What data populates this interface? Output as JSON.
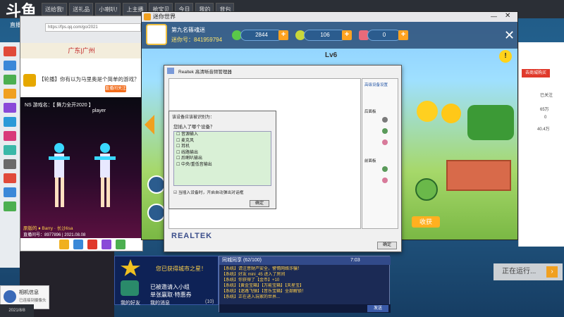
{
  "top_taskbar": {
    "items": [
      "送给我!",
      "送礼品",
      "小喇叭!",
      "上主播",
      "抢宝贝",
      "今日",
      "我的",
      "背包"
    ]
  },
  "douyu": {
    "logo": "斗鱼",
    "sub": "直播间号"
  },
  "browser": {
    "url": "https://fps.qq.com/go/2021",
    "city_banner": "广东|广州",
    "stream_title": "【轮播】你有以为马里奥是个简单的游戏？",
    "follow_label": "直播间关注 100+",
    "ns_label": "NS 游戏名：【 舞力全开2020 】",
    "player_label": "player",
    "dance_caption": "原版的 ♦ Barry · 长沙lisa",
    "dance_id": "直播间号：8977896 | 2021.08.08"
  },
  "game": {
    "app_title": "迷你世界",
    "player_name": "第九名篠魂迷",
    "player_id": "迷你号：841959794",
    "stat_coins": "2844",
    "stat_stars": "106",
    "stat_tickets": "0",
    "level": "Lv6",
    "harvest": "收获",
    "close_icon": "close-icon",
    "info_icon": "info-icon"
  },
  "realtek": {
    "title": "Realtek 高清晰音频管理器",
    "side_title": "高级设备设置",
    "side_analog": "后面板",
    "side_digital": "前面板",
    "brand": "REALTEK",
    "ok": "确定"
  },
  "device_popup": {
    "title": "该设备应该被识别为：",
    "question": "您插入了哪个设备？",
    "options": [
      "音源输入",
      "麦克风",
      "耳机",
      "线路输出",
      "后喇叭输出",
      "中央/重低音输出"
    ],
    "auto_popup_check": "当插入设备时，开启自动弹出对话框",
    "ok": "确定"
  },
  "chat": {
    "header": "同城同享 (62/100)",
    "time": "7:03",
    "lines": [
      "【系统】请注意财产安全，警惕网络诈骗！",
      "【系统】好友 mini_45 进入了房间",
      "【系统】你获得了【金币】+10",
      "【系统】【黄金宝箱】【万能宝箱】【天星宝】",
      "【系统】【迷路飞弹】【音乐宝箱】全部解锁！",
      "【系统】正在进入玩家的世界..."
    ],
    "send": "发送"
  },
  "friends": {
    "line1": "您已获得城市之星！",
    "line2": "已被邀请入小组",
    "line3": "单张赢取·特惠券",
    "tab1": "我的好友",
    "tab2": "我的消息",
    "count": "(10)"
  },
  "right_panel": {
    "btn": "去商城购买",
    "lines": [
      "已关注",
      "65万",
      "0",
      "40.4万"
    ]
  },
  "running_label": "正在运行...",
  "notification": {
    "title": "相机信息",
    "sub": "已连接到摄像头"
  },
  "clock": "2021/8/8"
}
